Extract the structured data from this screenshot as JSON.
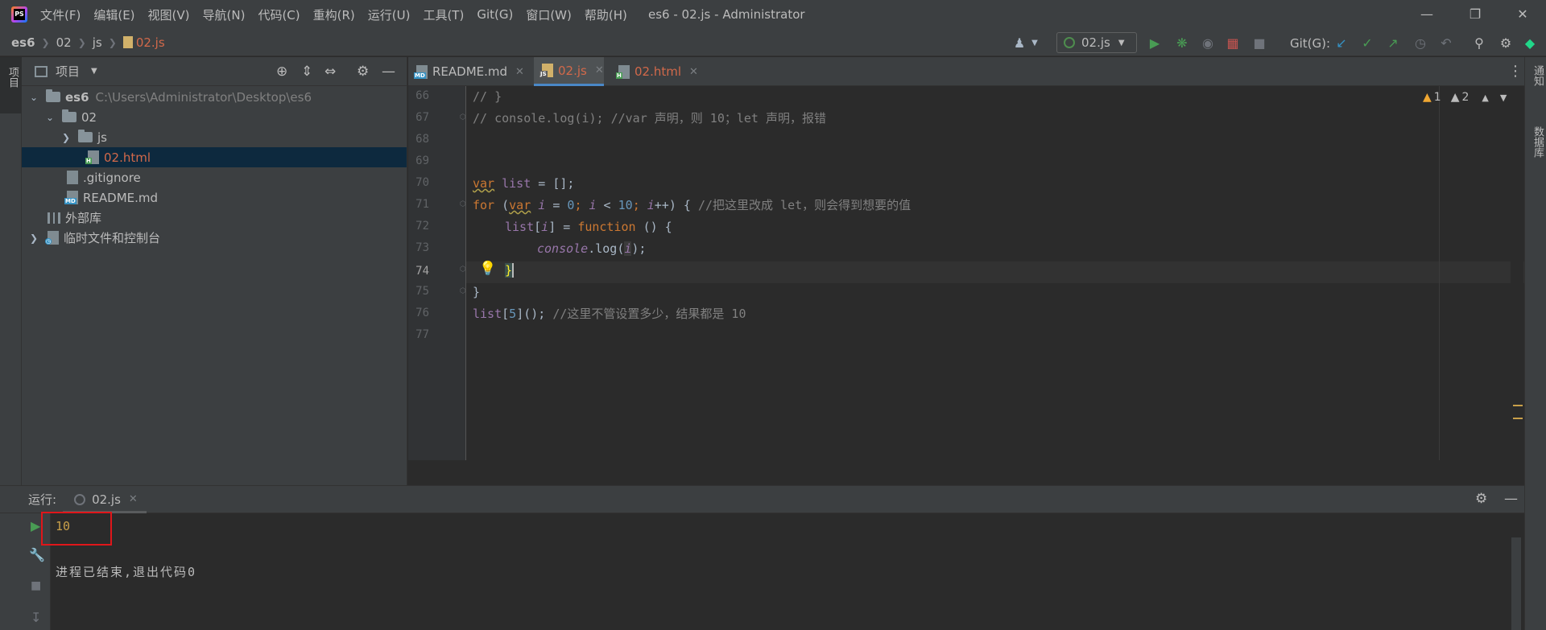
{
  "titlebar": {
    "menu": [
      "文件(F)",
      "编辑(E)",
      "视图(V)",
      "导航(N)",
      "代码(C)",
      "重构(R)",
      "运行(U)",
      "工具(T)",
      "Git(G)",
      "窗口(W)",
      "帮助(H)"
    ],
    "window_title": "es6 - 02.js - Administrator"
  },
  "navbar": {
    "breadcrumbs": [
      "es6",
      "02",
      "js",
      "02.js"
    ],
    "run_config": "02.js",
    "git_label": "Git(G):"
  },
  "left_strip": {
    "project_tab": "项目"
  },
  "right_strip": {
    "notifications": "通知",
    "database": "数据库"
  },
  "project_panel": {
    "title": "项目",
    "tree": [
      {
        "label": "es6",
        "path": "C:\\Users\\Administrator\\Desktop\\es6"
      },
      {
        "label": "02"
      },
      {
        "label": "js"
      },
      {
        "label": "02.html"
      },
      {
        "label": ".gitignore"
      },
      {
        "label": "README.md"
      },
      {
        "label": "外部库"
      },
      {
        "label": "临时文件和控制台"
      }
    ]
  },
  "editor_tabs": [
    {
      "label": "README.md",
      "badge": "MD"
    },
    {
      "label": "02.js",
      "badge": "JS"
    },
    {
      "label": "02.html",
      "badge": "H"
    }
  ],
  "editor": {
    "line_numbers": [
      "66",
      "67",
      "68",
      "69",
      "70",
      "71",
      "72",
      "73",
      "74",
      "75",
      "76",
      "77"
    ],
    "inspection": {
      "warnings": "1",
      "weak_warnings": "2"
    },
    "code": {
      "l66": "// }",
      "l67": "// console.log(i); //var 声明，则 10；let 声明，报错",
      "l70_kw": "var",
      "l70_var": "list",
      "l70_rest": " = [];",
      "l71_for": "for",
      "l71_open": " (",
      "l71_var": "var",
      "l71_i": "i",
      "l71_eq": " = ",
      "l71_zero": "0",
      "l71_semi1": "; ",
      "l71_i2": "i",
      "l71_lt": " < ",
      "l71_ten": "10",
      "l71_semi2": "; ",
      "l71_i3": "i",
      "l71_inc": "++) { ",
      "l71_comment": "//把这里改成 let，则会得到想要的值",
      "l72_list": "list",
      "l72_b1": "[",
      "l72_i": "i",
      "l72_b2": "] = ",
      "l72_fn": "function",
      "l72_rest": " () {",
      "l73_console": "console",
      "l73_dot": ".log(",
      "l73_i": "i",
      "l73_end": ");",
      "l74": "}",
      "l75": "}",
      "l76_list": "list",
      "l76_b1": "[",
      "l76_five": "5",
      "l76_b2": "](); ",
      "l76_comment": "//这里不管设置多少，结果都是 10"
    }
  },
  "run_panel": {
    "label": "运行:",
    "tab": "02.js",
    "output_value": "10",
    "exit_message": "进程已结束,退出代码0"
  }
}
